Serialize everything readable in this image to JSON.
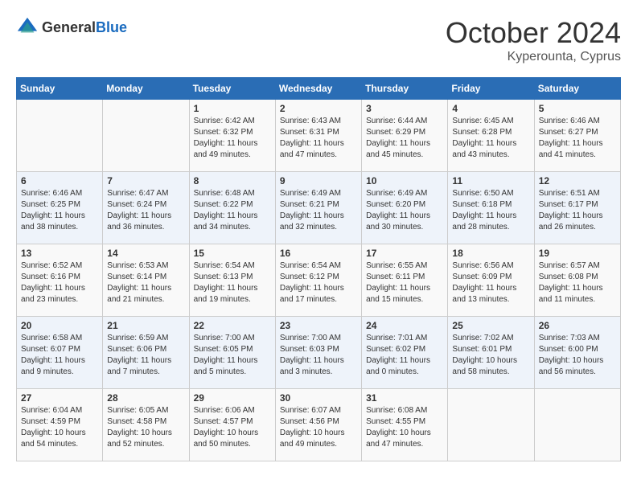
{
  "header": {
    "logo_general": "General",
    "logo_blue": "Blue",
    "month": "October 2024",
    "location": "Kyperounta, Cyprus"
  },
  "days_of_week": [
    "Sunday",
    "Monday",
    "Tuesday",
    "Wednesday",
    "Thursday",
    "Friday",
    "Saturday"
  ],
  "weeks": [
    [
      {
        "day": "",
        "info": ""
      },
      {
        "day": "",
        "info": ""
      },
      {
        "day": "1",
        "sunrise": "Sunrise: 6:42 AM",
        "sunset": "Sunset: 6:32 PM",
        "daylight": "Daylight: 11 hours and 49 minutes."
      },
      {
        "day": "2",
        "sunrise": "Sunrise: 6:43 AM",
        "sunset": "Sunset: 6:31 PM",
        "daylight": "Daylight: 11 hours and 47 minutes."
      },
      {
        "day": "3",
        "sunrise": "Sunrise: 6:44 AM",
        "sunset": "Sunset: 6:29 PM",
        "daylight": "Daylight: 11 hours and 45 minutes."
      },
      {
        "day": "4",
        "sunrise": "Sunrise: 6:45 AM",
        "sunset": "Sunset: 6:28 PM",
        "daylight": "Daylight: 11 hours and 43 minutes."
      },
      {
        "day": "5",
        "sunrise": "Sunrise: 6:46 AM",
        "sunset": "Sunset: 6:27 PM",
        "daylight": "Daylight: 11 hours and 41 minutes."
      }
    ],
    [
      {
        "day": "6",
        "sunrise": "Sunrise: 6:46 AM",
        "sunset": "Sunset: 6:25 PM",
        "daylight": "Daylight: 11 hours and 38 minutes."
      },
      {
        "day": "7",
        "sunrise": "Sunrise: 6:47 AM",
        "sunset": "Sunset: 6:24 PM",
        "daylight": "Daylight: 11 hours and 36 minutes."
      },
      {
        "day": "8",
        "sunrise": "Sunrise: 6:48 AM",
        "sunset": "Sunset: 6:22 PM",
        "daylight": "Daylight: 11 hours and 34 minutes."
      },
      {
        "day": "9",
        "sunrise": "Sunrise: 6:49 AM",
        "sunset": "Sunset: 6:21 PM",
        "daylight": "Daylight: 11 hours and 32 minutes."
      },
      {
        "day": "10",
        "sunrise": "Sunrise: 6:49 AM",
        "sunset": "Sunset: 6:20 PM",
        "daylight": "Daylight: 11 hours and 30 minutes."
      },
      {
        "day": "11",
        "sunrise": "Sunrise: 6:50 AM",
        "sunset": "Sunset: 6:18 PM",
        "daylight": "Daylight: 11 hours and 28 minutes."
      },
      {
        "day": "12",
        "sunrise": "Sunrise: 6:51 AM",
        "sunset": "Sunset: 6:17 PM",
        "daylight": "Daylight: 11 hours and 26 minutes."
      }
    ],
    [
      {
        "day": "13",
        "sunrise": "Sunrise: 6:52 AM",
        "sunset": "Sunset: 6:16 PM",
        "daylight": "Daylight: 11 hours and 23 minutes."
      },
      {
        "day": "14",
        "sunrise": "Sunrise: 6:53 AM",
        "sunset": "Sunset: 6:14 PM",
        "daylight": "Daylight: 11 hours and 21 minutes."
      },
      {
        "day": "15",
        "sunrise": "Sunrise: 6:54 AM",
        "sunset": "Sunset: 6:13 PM",
        "daylight": "Daylight: 11 hours and 19 minutes."
      },
      {
        "day": "16",
        "sunrise": "Sunrise: 6:54 AM",
        "sunset": "Sunset: 6:12 PM",
        "daylight": "Daylight: 11 hours and 17 minutes."
      },
      {
        "day": "17",
        "sunrise": "Sunrise: 6:55 AM",
        "sunset": "Sunset: 6:11 PM",
        "daylight": "Daylight: 11 hours and 15 minutes."
      },
      {
        "day": "18",
        "sunrise": "Sunrise: 6:56 AM",
        "sunset": "Sunset: 6:09 PM",
        "daylight": "Daylight: 11 hours and 13 minutes."
      },
      {
        "day": "19",
        "sunrise": "Sunrise: 6:57 AM",
        "sunset": "Sunset: 6:08 PM",
        "daylight": "Daylight: 11 hours and 11 minutes."
      }
    ],
    [
      {
        "day": "20",
        "sunrise": "Sunrise: 6:58 AM",
        "sunset": "Sunset: 6:07 PM",
        "daylight": "Daylight: 11 hours and 9 minutes."
      },
      {
        "day": "21",
        "sunrise": "Sunrise: 6:59 AM",
        "sunset": "Sunset: 6:06 PM",
        "daylight": "Daylight: 11 hours and 7 minutes."
      },
      {
        "day": "22",
        "sunrise": "Sunrise: 7:00 AM",
        "sunset": "Sunset: 6:05 PM",
        "daylight": "Daylight: 11 hours and 5 minutes."
      },
      {
        "day": "23",
        "sunrise": "Sunrise: 7:00 AM",
        "sunset": "Sunset: 6:03 PM",
        "daylight": "Daylight: 11 hours and 3 minutes."
      },
      {
        "day": "24",
        "sunrise": "Sunrise: 7:01 AM",
        "sunset": "Sunset: 6:02 PM",
        "daylight": "Daylight: 11 hours and 0 minutes."
      },
      {
        "day": "25",
        "sunrise": "Sunrise: 7:02 AM",
        "sunset": "Sunset: 6:01 PM",
        "daylight": "Daylight: 10 hours and 58 minutes."
      },
      {
        "day": "26",
        "sunrise": "Sunrise: 7:03 AM",
        "sunset": "Sunset: 6:00 PM",
        "daylight": "Daylight: 10 hours and 56 minutes."
      }
    ],
    [
      {
        "day": "27",
        "sunrise": "Sunrise: 6:04 AM",
        "sunset": "Sunset: 4:59 PM",
        "daylight": "Daylight: 10 hours and 54 minutes."
      },
      {
        "day": "28",
        "sunrise": "Sunrise: 6:05 AM",
        "sunset": "Sunset: 4:58 PM",
        "daylight": "Daylight: 10 hours and 52 minutes."
      },
      {
        "day": "29",
        "sunrise": "Sunrise: 6:06 AM",
        "sunset": "Sunset: 4:57 PM",
        "daylight": "Daylight: 10 hours and 50 minutes."
      },
      {
        "day": "30",
        "sunrise": "Sunrise: 6:07 AM",
        "sunset": "Sunset: 4:56 PM",
        "daylight": "Daylight: 10 hours and 49 minutes."
      },
      {
        "day": "31",
        "sunrise": "Sunrise: 6:08 AM",
        "sunset": "Sunset: 4:55 PM",
        "daylight": "Daylight: 10 hours and 47 minutes."
      },
      {
        "day": "",
        "info": ""
      },
      {
        "day": "",
        "info": ""
      }
    ]
  ]
}
